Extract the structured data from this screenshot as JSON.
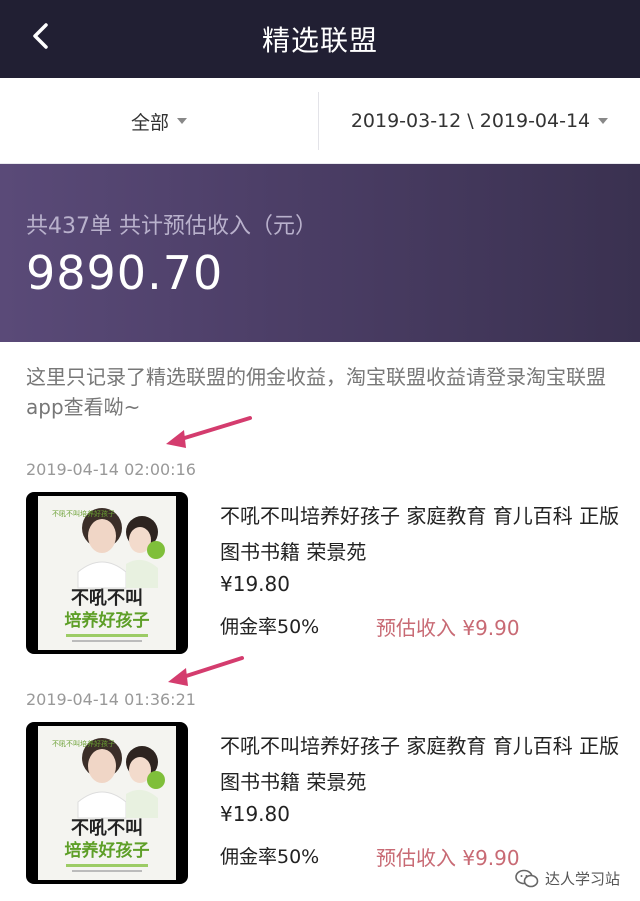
{
  "header": {
    "title": "精选联盟",
    "back_icon": "chevron-left-icon"
  },
  "filters": {
    "category": "全部",
    "date_range": "2019-03-12 \\ 2019-04-14"
  },
  "summary": {
    "label": "共437单 共计预估收入（元）",
    "amount": "9890.70"
  },
  "note": "这里只记录了精选联盟的佣金收益，淘宝联盟收益请登录淘宝联盟app查看呦~",
  "colors": {
    "header_bg": "#211f33",
    "banner_bg": "#4d3f68",
    "income": "#c86a74",
    "arrow": "#d43c6e"
  },
  "orders": [
    {
      "timestamp": "2019-04-14 02:00:16",
      "title": "不吼不叫培养好孩子 家庭教育 育儿百科 正版图书书籍 荣景苑",
      "price": "¥19.80",
      "rate": "佣金率50%",
      "income": "预估收入 ¥9.90",
      "cover": {
        "heading": "不吼不叫",
        "subheading": "培养好孩子"
      }
    },
    {
      "timestamp": "2019-04-14 01:36:21",
      "title": "不吼不叫培养好孩子 家庭教育 育儿百科 正版图书书籍 荣景苑",
      "price": "¥19.80",
      "rate": "佣金率50%",
      "income": "预估收入 ¥9.90",
      "cover": {
        "heading": "不吼不叫",
        "subheading": "培养好孩子"
      }
    }
  ],
  "watermark": {
    "icon": "wechat-icon",
    "text": "达人学习站"
  }
}
